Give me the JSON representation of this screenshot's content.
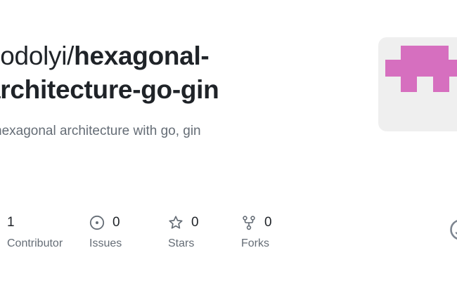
{
  "repo": {
    "owner": "dodolyi/",
    "name_part1": "hexagonal-",
    "name_part2": "architecture-go-gin",
    "owner_partial": "dodolyi/",
    "description": "hexagonal architecture with go, gin"
  },
  "avatar": {
    "icon": "identicon",
    "color": "#d66fbf",
    "background": "#efefef"
  },
  "stats": {
    "contributors": {
      "value": "1",
      "label": "Contributor",
      "icon": "people-icon"
    },
    "issues": {
      "value": "0",
      "label": "Issues",
      "icon": "issue-opened-icon"
    },
    "stars": {
      "value": "0",
      "label": "Stars",
      "icon": "star-icon"
    },
    "forks": {
      "value": "0",
      "label": "Forks",
      "icon": "repo-forked-icon"
    }
  },
  "brand": {
    "icon": "github-mark-icon",
    "color": "#7d8590"
  }
}
